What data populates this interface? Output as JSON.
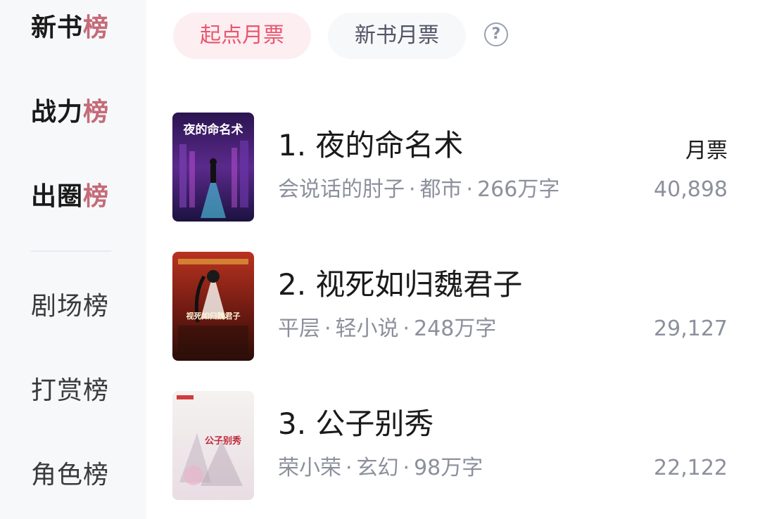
{
  "sidebar": {
    "items": [
      {
        "label_main": "新书",
        "label_last": "榜"
      },
      {
        "label_main": "战力",
        "label_last": "榜"
      },
      {
        "label_main": "出圈",
        "label_last": "榜"
      },
      {
        "label": "剧场榜"
      },
      {
        "label": "打赏榜"
      },
      {
        "label": "角色榜"
      }
    ]
  },
  "tabs": [
    {
      "label": "起点月票",
      "active": true
    },
    {
      "label": "新书月票",
      "active": false
    }
  ],
  "help_icon": {
    "glyph": "?",
    "icon": "question-circle-icon"
  },
  "column_header": {
    "ticket_label": "月票"
  },
  "books": [
    {
      "rank_title": "1. 夜的命名术",
      "author": "会说话的肘子",
      "genre": "都市",
      "words": "266万字",
      "tickets": "40,898",
      "cover_text": "夜的命名术"
    },
    {
      "rank_title": "2. 视死如归魏君子",
      "author": "平层",
      "genre": "轻小说",
      "words": "248万字",
      "tickets": "29,127",
      "cover_text": "视死如归魏君子"
    },
    {
      "rank_title": "3. 公子别秀",
      "author": "荣小荣",
      "genre": "玄幻",
      "words": "98万字",
      "tickets": "22,122",
      "cover_text": "公子别秀"
    }
  ],
  "colors": {
    "accent": "#e8566f",
    "accent_bg": "#fdeef1",
    "muted": "#8c909c"
  }
}
